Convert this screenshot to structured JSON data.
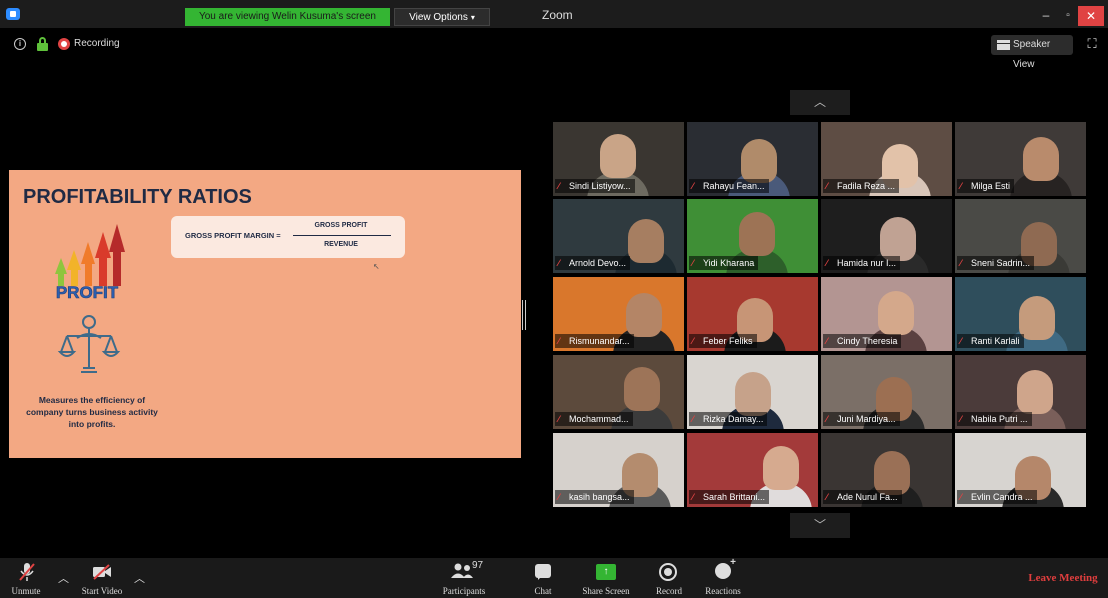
{
  "titlebar": {
    "viewing_banner": "You are viewing Welin Kusuma's screen",
    "view_options": "View Options",
    "window_title": "Zoom",
    "minimize": "–",
    "maximize": "▫",
    "close": "✕"
  },
  "topbar": {
    "recording": "Recording",
    "speaker_view": "Speaker View"
  },
  "slide": {
    "title": "PROFITABILITY RATIOS",
    "formula_label": "GROSS PROFIT MARGIN =",
    "formula_numerator": "GROSS PROFIT",
    "formula_denominator": "REVENUE",
    "graphic_text": "PROFIT",
    "caption": "Measures the efficiency of company turns business activity into profits."
  },
  "gallery": {
    "participants": [
      {
        "name": "Sindi Listiyow...",
        "bg": "#3a3631",
        "face": "#c9a487",
        "shirt": "#6d6a60"
      },
      {
        "name": "Rahayu Fean...",
        "bg": "#2a2d33",
        "face": "#b08b6a",
        "shirt": "#4a5a7a"
      },
      {
        "name": "Fadila Reza ...",
        "bg": "#5e4d44",
        "face": "#e2c2a9",
        "shirt": "#d8c5b8"
      },
      {
        "name": "Milga Esti",
        "bg": "#3f3a38",
        "face": "#b98b6c",
        "shirt": "#272322"
      },
      {
        "name": "Arnold Devo...",
        "bg": "#2f3a3f",
        "face": "#a67e61",
        "shirt": "#1d2a31"
      },
      {
        "name": "Yidi Kharana",
        "bg": "#3f8f36",
        "face": "#9d7355",
        "shirt": "#2d5f2a"
      },
      {
        "name": "Hamida nur I...",
        "bg": "#1e1e1e",
        "face": "#c0a293",
        "shirt": "#2a2a2a"
      },
      {
        "name": "Sneni Sadrin...",
        "bg": "#4a4a46",
        "face": "#8f6a52",
        "shirt": "#3a3a36"
      },
      {
        "name": "Rismunandar...",
        "bg": "#d9772c",
        "face": "#b48566",
        "shirt": "#222222"
      },
      {
        "name": "Feber Feliks",
        "bg": "#a7392f",
        "face": "#c79576",
        "shirt": "#1b1b1b"
      },
      {
        "name": "Cindy Theresia",
        "bg": "#b39592",
        "face": "#d4a88b",
        "shirt": "#5a4040"
      },
      {
        "name": "Ranti Karlali",
        "bg": "#2f4e5c",
        "face": "#c59b7c",
        "shirt": "#3f6a83"
      },
      {
        "name": "Mochammad...",
        "bg": "#5c4a3c",
        "face": "#9d7458",
        "shirt": "#3b3b3b"
      },
      {
        "name": "Rizka Damay...",
        "bg": "#d9d5d0",
        "face": "#c6a28a",
        "shirt": "#1e2a3d"
      },
      {
        "name": "Juni Mardiya...",
        "bg": "#7b6f67",
        "face": "#9c6f52",
        "shirt": "#2c2c2c"
      },
      {
        "name": "Nabila Putri ...",
        "bg": "#4b3b3a",
        "face": "#cfa58b",
        "shirt": "#7a5f5a"
      },
      {
        "name": "kasih bangsa...",
        "bg": "#d6d1cc",
        "face": "#b48c6e",
        "shirt": "#5a5a5a"
      },
      {
        "name": "Sarah Brittani...",
        "bg": "#a33a3a",
        "face": "#d6aa8f",
        "shirt": "#e0dcdc"
      },
      {
        "name": "Ade Nurul Fa...",
        "bg": "#3a3533",
        "face": "#9a7056",
        "shirt": "#1f1f1f"
      },
      {
        "name": "Evlin Candra ...",
        "bg": "#d7d4d0",
        "face": "#b5876a",
        "shirt": "#2a2a2a"
      }
    ]
  },
  "toolbar": {
    "unmute": "Unmute",
    "start_video": "Start Video",
    "participants": "Participants",
    "participant_count": "97",
    "chat": "Chat",
    "share_screen": "Share Screen",
    "record": "Record",
    "reactions": "Reactions",
    "leave_meeting": "Leave Meeting"
  },
  "colors": {
    "accent_green": "#34b533",
    "slide_bg": "#f3a883",
    "leave_red": "#e03e3e"
  }
}
